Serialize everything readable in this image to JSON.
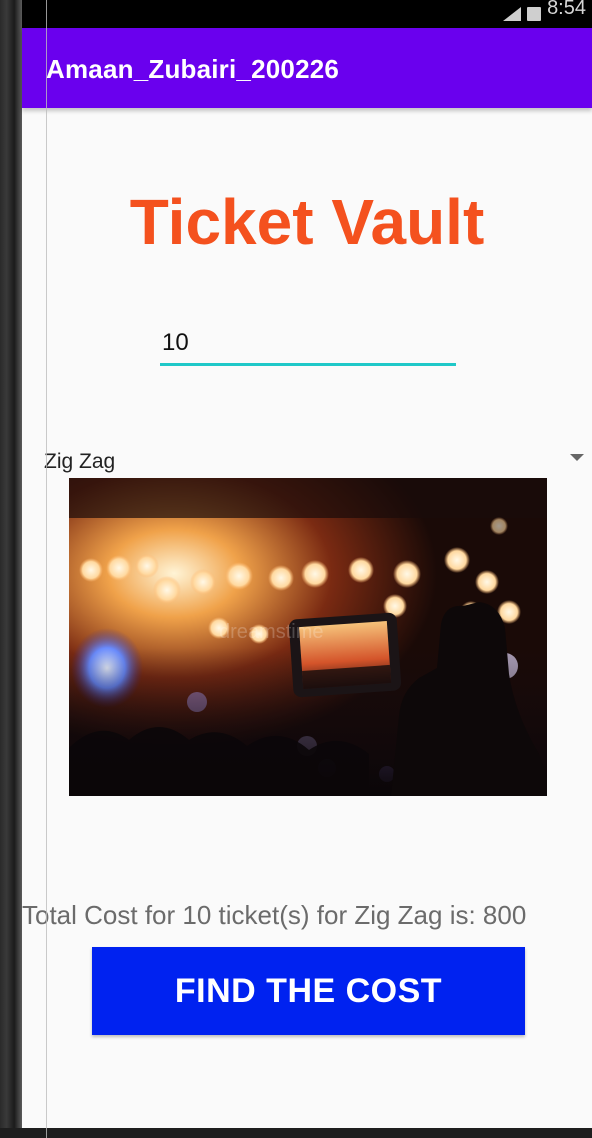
{
  "status_bar": {
    "time": "8:54",
    "icons": [
      "signal-icon",
      "battery-icon"
    ]
  },
  "app_bar": {
    "title": "Amaan_Zubairi_200226",
    "color": "#6a00ee"
  },
  "main": {
    "heading": "Ticket Vault",
    "heading_color": "#f4511e",
    "quantity_input": {
      "value": "10",
      "underline_color": "#1fc8c8"
    },
    "event_spinner": {
      "selected": "Zig Zag",
      "icon": "dropdown-arrow-icon"
    },
    "image": {
      "subject": "concert crowd filming stage with phone",
      "watermark": "dreamstime"
    },
    "result_text": "Total Cost for 10 ticket(s) for Zig Zag is: 800",
    "find_button": {
      "label": "FIND THE COST",
      "color": "#0022f0"
    }
  }
}
